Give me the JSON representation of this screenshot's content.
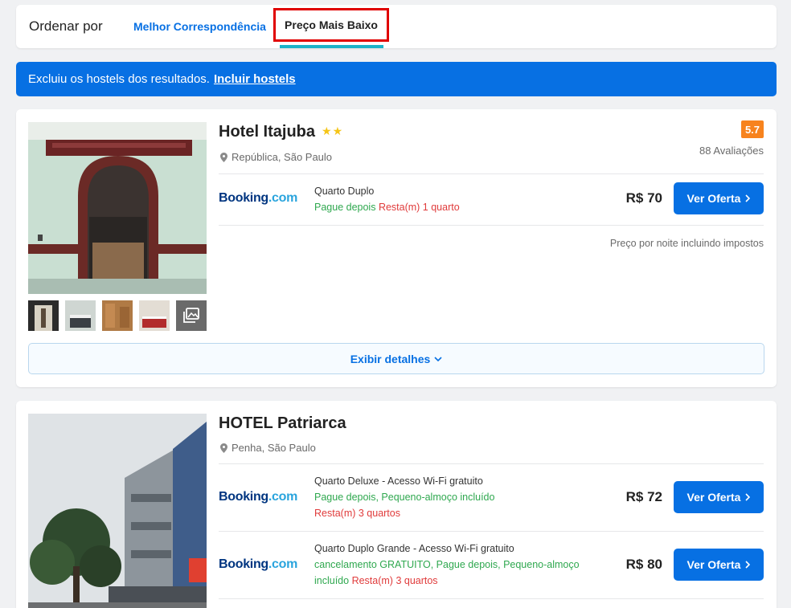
{
  "sort": {
    "label": "Ordenar por",
    "tabs": [
      {
        "label": "Melhor Correspondência",
        "active": false
      },
      {
        "label": "Preço Mais Baixo",
        "active": true
      }
    ]
  },
  "banner": {
    "text": "Excluiu os hostels dos resultados.",
    "link": "Incluir hostels"
  },
  "hotels": [
    {
      "name": "Hotel Itajuba",
      "stars": "★★",
      "location": "República, São Paulo",
      "rating": "5.7",
      "reviews": "88 Avaliações",
      "offers": [
        {
          "provider": "Booking",
          "provider_suffix": ".com",
          "room": "Quarto Duplo",
          "line2_green": "Pague depois",
          "line2_red": "Resta(m) 1 quarto",
          "price": "R$ 70",
          "button": "Ver Oferta"
        }
      ],
      "per_night": "Preço por noite incluindo impostos",
      "details_button": "Exibir detalhes"
    },
    {
      "name": "HOTEL Patriarca",
      "location": "Penha, São Paulo",
      "offers": [
        {
          "provider": "Booking",
          "provider_suffix": ".com",
          "room": "Quarto Deluxe - Acesso Wi-Fi gratuito",
          "line2_green": "Pague depois, Pequeno-almoço incluído",
          "line3_red": "Resta(m) 3 quartos",
          "price": "R$ 72",
          "button": "Ver Oferta"
        },
        {
          "provider": "Booking",
          "provider_suffix": ".com",
          "room": "Quarto Duplo Grande - Acesso Wi-Fi gratuito",
          "line2_green": "cancelamento GRATUITO, Pague depois, Pequeno-almoço",
          "line3_green": "incluído",
          "line3_red": "Resta(m) 3 quartos",
          "price": "R$ 80",
          "button": "Ver Oferta"
        }
      ]
    }
  ],
  "colors": {
    "accent": "#0770e3",
    "rating": "#f7831e",
    "highlight_border": "#e00000",
    "tab_underline": "#1bb3c9",
    "green_text": "#2fa84f",
    "red_text": "#e03b3b"
  }
}
